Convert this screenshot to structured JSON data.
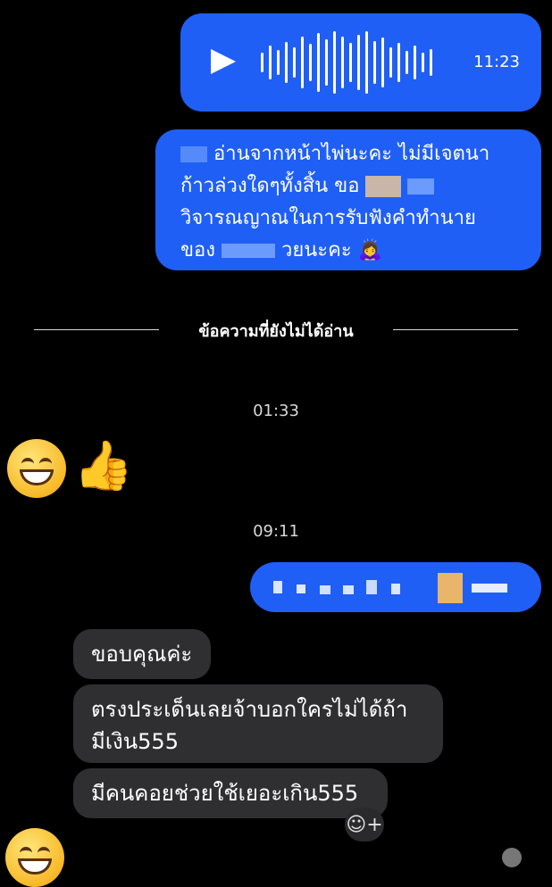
{
  "voice_message": {
    "time": "11:23"
  },
  "outgoing_text": {
    "lines": [
      "อ่านจากหน้าไพ่นะคะ ไม่มีเจตนา",
      "ก้าวล่วงใดๆทั้งสิ้น ขอ",
      "วิจารณญาณในการรับฟังคำทำนาย",
      "ของ",
      "วยนะคะ 🙇‍♀️"
    ]
  },
  "unread_divider": {
    "label": "ข้อความที่ยังไม่ได้อ่าน"
  },
  "timestamps": [
    "01:33",
    "09:11"
  ],
  "incoming_messages": [
    "ขอบคุณค่ะ",
    "ตรงประเด็นเลยจ้าบอกใครไม่ได้ถ้า",
    "มีเงิน555",
    "มีคนคอยช่วยใช้เยอะเกิน555"
  ],
  "icons": {
    "play": "play-icon",
    "thumbs_up": "thumbs-up-icon",
    "smile_emoji": "grinning-face-emoji",
    "add_reaction": "add-reaction-icon"
  },
  "colors": {
    "outgoing_bubble": "#1f5ff5",
    "incoming_bubble": "#2f2f31",
    "background": "#000000",
    "thumb": "#1877f2"
  }
}
